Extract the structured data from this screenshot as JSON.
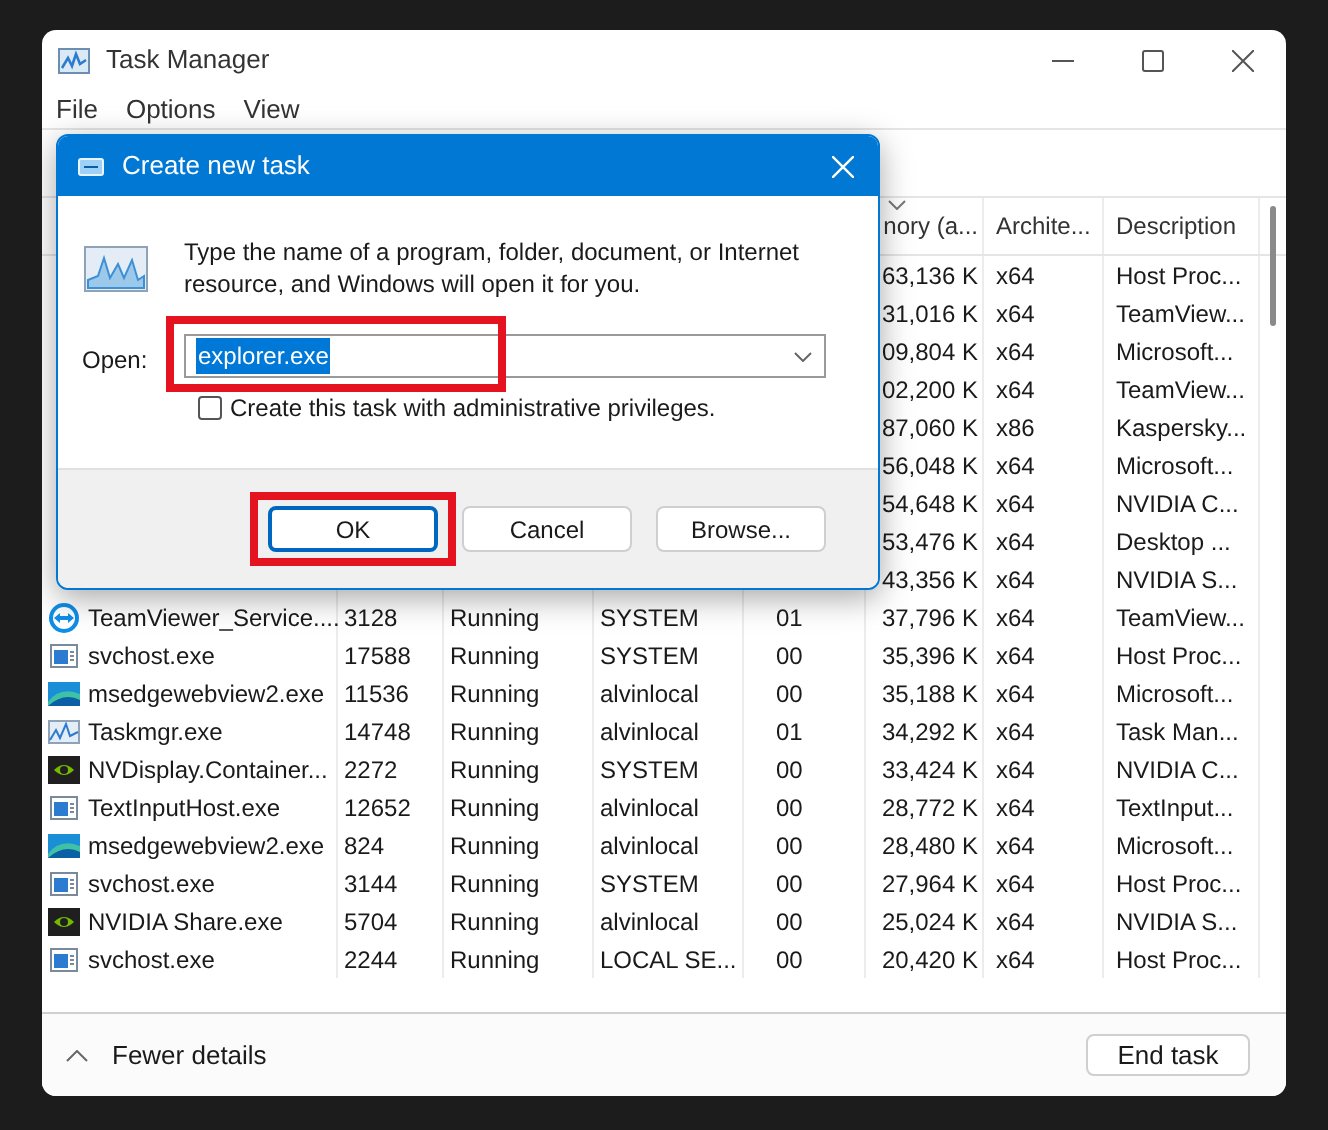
{
  "window": {
    "title": "Task Manager"
  },
  "menu": [
    "File",
    "Options",
    "View"
  ],
  "table": {
    "columns": [
      {
        "label": "nory (a..."
      },
      {
        "label": "Archite..."
      },
      {
        "label": "Description"
      }
    ],
    "rows": [
      {
        "memory": "63,136 K",
        "architecture": "x64",
        "description": "Host Proc..."
      },
      {
        "memory": "31,016 K",
        "architecture": "x64",
        "description": "TeamView..."
      },
      {
        "memory": "09,804 K",
        "architecture": "x64",
        "description": "Microsoft..."
      },
      {
        "memory": "02,200 K",
        "architecture": "x64",
        "description": "TeamView..."
      },
      {
        "memory": "87,060 K",
        "architecture": "x86",
        "description": "Kaspersky..."
      },
      {
        "memory": "56,048 K",
        "architecture": "x64",
        "description": "Microsoft..."
      },
      {
        "memory": "54,648 K",
        "architecture": "x64",
        "description": "NVIDIA C..."
      },
      {
        "memory": "53,476 K",
        "architecture": "x64",
        "description": "Desktop ..."
      },
      {
        "memory": "43,356 K",
        "architecture": "x64",
        "description": "NVIDIA S..."
      },
      {
        "kind": "teamviewer",
        "name": "TeamViewer_Service....",
        "pid": "3128",
        "status": "Running",
        "user": "SYSTEM",
        "cpu": "01",
        "memory": "37,796 K",
        "architecture": "x64",
        "description": "TeamView..."
      },
      {
        "kind": "service",
        "name": "svchost.exe",
        "pid": "17588",
        "status": "Running",
        "user": "SYSTEM",
        "cpu": "00",
        "memory": "35,396 K",
        "architecture": "x64",
        "description": "Host Proc..."
      },
      {
        "kind": "edge",
        "name": "msedgewebview2.exe",
        "pid": "11536",
        "status": "Running",
        "user": "alvinlocal",
        "cpu": "00",
        "memory": "35,188 K",
        "architecture": "x64",
        "description": "Microsoft..."
      },
      {
        "kind": "taskmgr",
        "name": "Taskmgr.exe",
        "pid": "14748",
        "status": "Running",
        "user": "alvinlocal",
        "cpu": "01",
        "memory": "34,292 K",
        "architecture": "x64",
        "description": "Task Man..."
      },
      {
        "kind": "nvidia",
        "name": "NVDisplay.Container...",
        "pid": "2272",
        "status": "Running",
        "user": "SYSTEM",
        "cpu": "00",
        "memory": "33,424 K",
        "architecture": "x64",
        "description": "NVIDIA C..."
      },
      {
        "kind": "service",
        "name": "TextInputHost.exe",
        "pid": "12652",
        "status": "Running",
        "user": "alvinlocal",
        "cpu": "00",
        "memory": "28,772 K",
        "architecture": "x64",
        "description": "TextInput..."
      },
      {
        "kind": "edge",
        "name": "msedgewebview2.exe",
        "pid": "824",
        "status": "Running",
        "user": "alvinlocal",
        "cpu": "00",
        "memory": "28,480 K",
        "architecture": "x64",
        "description": "Microsoft..."
      },
      {
        "kind": "service",
        "name": "svchost.exe",
        "pid": "3144",
        "status": "Running",
        "user": "SYSTEM",
        "cpu": "00",
        "memory": "27,964 K",
        "architecture": "x64",
        "description": "Host Proc..."
      },
      {
        "kind": "nvidia",
        "name": "NVIDIA Share.exe",
        "pid": "5704",
        "status": "Running",
        "user": "alvinlocal",
        "cpu": "00",
        "memory": "25,024 K",
        "architecture": "x64",
        "description": "NVIDIA S..."
      },
      {
        "kind": "service",
        "name": "svchost.exe",
        "pid": "2244",
        "status": "Running",
        "user": "LOCAL SE...",
        "cpu": "00",
        "memory": "20,420 K",
        "architecture": "x64",
        "description": "Host Proc..."
      }
    ]
  },
  "footer": {
    "toggle": "Fewer details",
    "button": "End task"
  },
  "dialog": {
    "title": "Create new task",
    "message": "Type the name of a program, folder, document, or Internet resource, and Windows will open it for you.",
    "open_label": "Open:",
    "open_value": "explorer.exe",
    "value_selected": true,
    "open_highlighted": true,
    "checkbox": {
      "label": "Create this task with administrative privileges.",
      "checked": false
    },
    "buttons": [
      {
        "label": "OK",
        "default": true,
        "highlighted": true
      },
      {
        "label": "Cancel",
        "default": false,
        "highlighted": false
      },
      {
        "label": "Browse...",
        "default": false,
        "highlighted": false
      }
    ]
  }
}
